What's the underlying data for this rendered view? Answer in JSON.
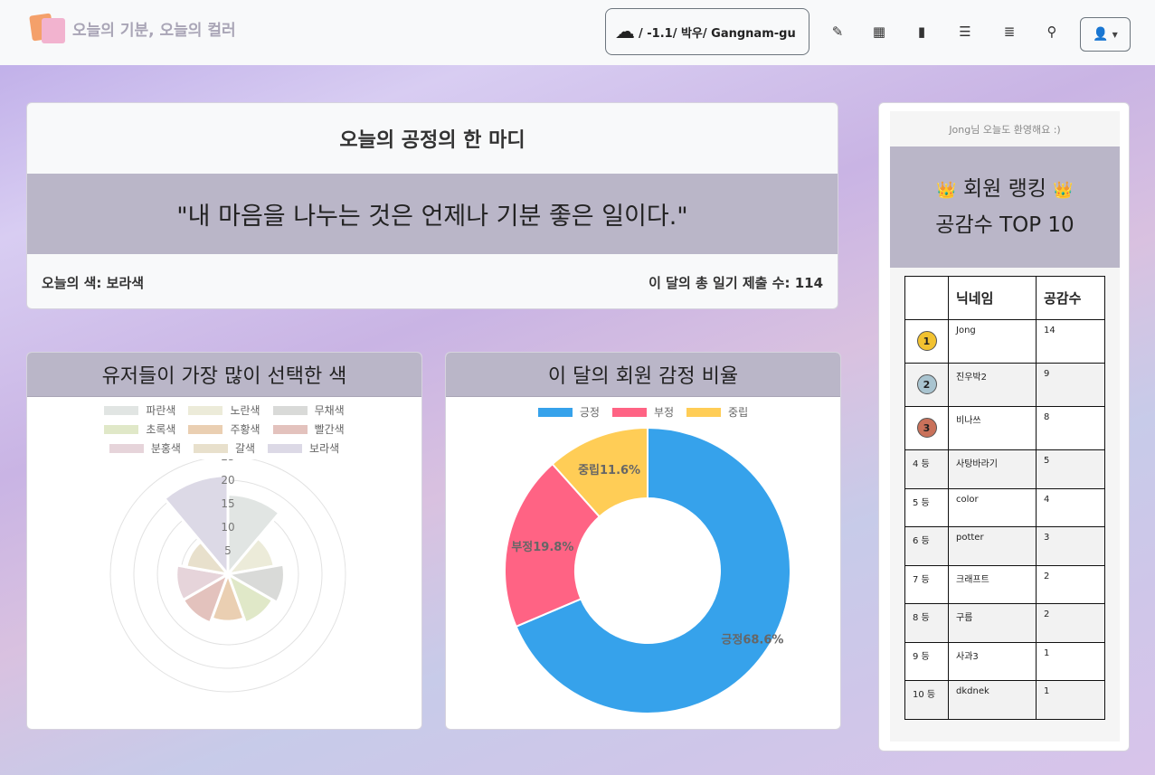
{
  "nav": {
    "brand": "오늘의 기분, 오늘의 컬러",
    "weather": "/ -1.1/ 박우/ Gangnam-gu",
    "icons": [
      "edit-icon",
      "calendar-icon",
      "book-icon",
      "list-icon",
      "list-alt-icon",
      "map-marker-icon"
    ],
    "user_icon": "user-icon"
  },
  "quote": {
    "title": "오늘의 공정의 한 마디",
    "text": "\"내 마음을 나누는 것은 언제나 기분 좋은 일이다.\"",
    "color_label": "오늘의 색: 보라색",
    "count_label": "이 달의 총 일기 제출 수: 114"
  },
  "colors_chart": {
    "title": "유저들이 가장 많이 선택한 색"
  },
  "emotion_chart": {
    "title": "이 달의 회원 감정 비율"
  },
  "chart_data": [
    {
      "type": "polarArea",
      "categories": [
        "파란색",
        "노란색",
        "무채색",
        "초록색",
        "주황색",
        "빨간색",
        "분홍색",
        "갈색",
        "보라색"
      ],
      "values": [
        17,
        10,
        12,
        11,
        10,
        11,
        11,
        9,
        21
      ],
      "rlim": [
        0,
        25
      ],
      "ticks": [
        "5",
        "10",
        "15",
        "20",
        "25"
      ],
      "colors": [
        "#e1e5e3",
        "#ecebd9",
        "#d9dad8",
        "#e0e8c8",
        "#eacfb2",
        "#e3c2bd",
        "#e6d4da",
        "#e8e0cc",
        "#dcd9e6"
      ],
      "legend": "top"
    },
    {
      "type": "doughnut",
      "categories": [
        "긍정",
        "부정",
        "중립"
      ],
      "values": [
        68.6,
        19.8,
        11.6
      ],
      "labels": [
        "긍정68.6%",
        "부정19.8%",
        "중립11.6%"
      ],
      "colors": [
        "#36a2eb",
        "#ff6384",
        "#ffcd56"
      ],
      "legend": "top"
    }
  ],
  "ranking": {
    "welcome": "Jong님 오늘도 환영해요 :)",
    "title1": "회원 랭킹",
    "title2": "공감수 TOP 10",
    "col_nick": "닉네임",
    "col_count": "공감수",
    "rows": [
      {
        "rank": "1",
        "nick": "Jong",
        "count": "14"
      },
      {
        "rank": "2",
        "nick": "진우박2",
        "count": "9"
      },
      {
        "rank": "3",
        "nick": "비나쓰",
        "count": "8"
      },
      {
        "rank": "4 등",
        "nick": "사탕바라기",
        "count": "5"
      },
      {
        "rank": "5 등",
        "nick": "color",
        "count": "4"
      },
      {
        "rank": "6 등",
        "nick": "potter",
        "count": "3"
      },
      {
        "rank": "7 등",
        "nick": "크래프트",
        "count": "2"
      },
      {
        "rank": "8 등",
        "nick": "구름",
        "count": "2"
      },
      {
        "rank": "9 등",
        "nick": "사과3",
        "count": "1"
      },
      {
        "rank": "10 등",
        "nick": "dkdnek",
        "count": "1"
      }
    ]
  }
}
